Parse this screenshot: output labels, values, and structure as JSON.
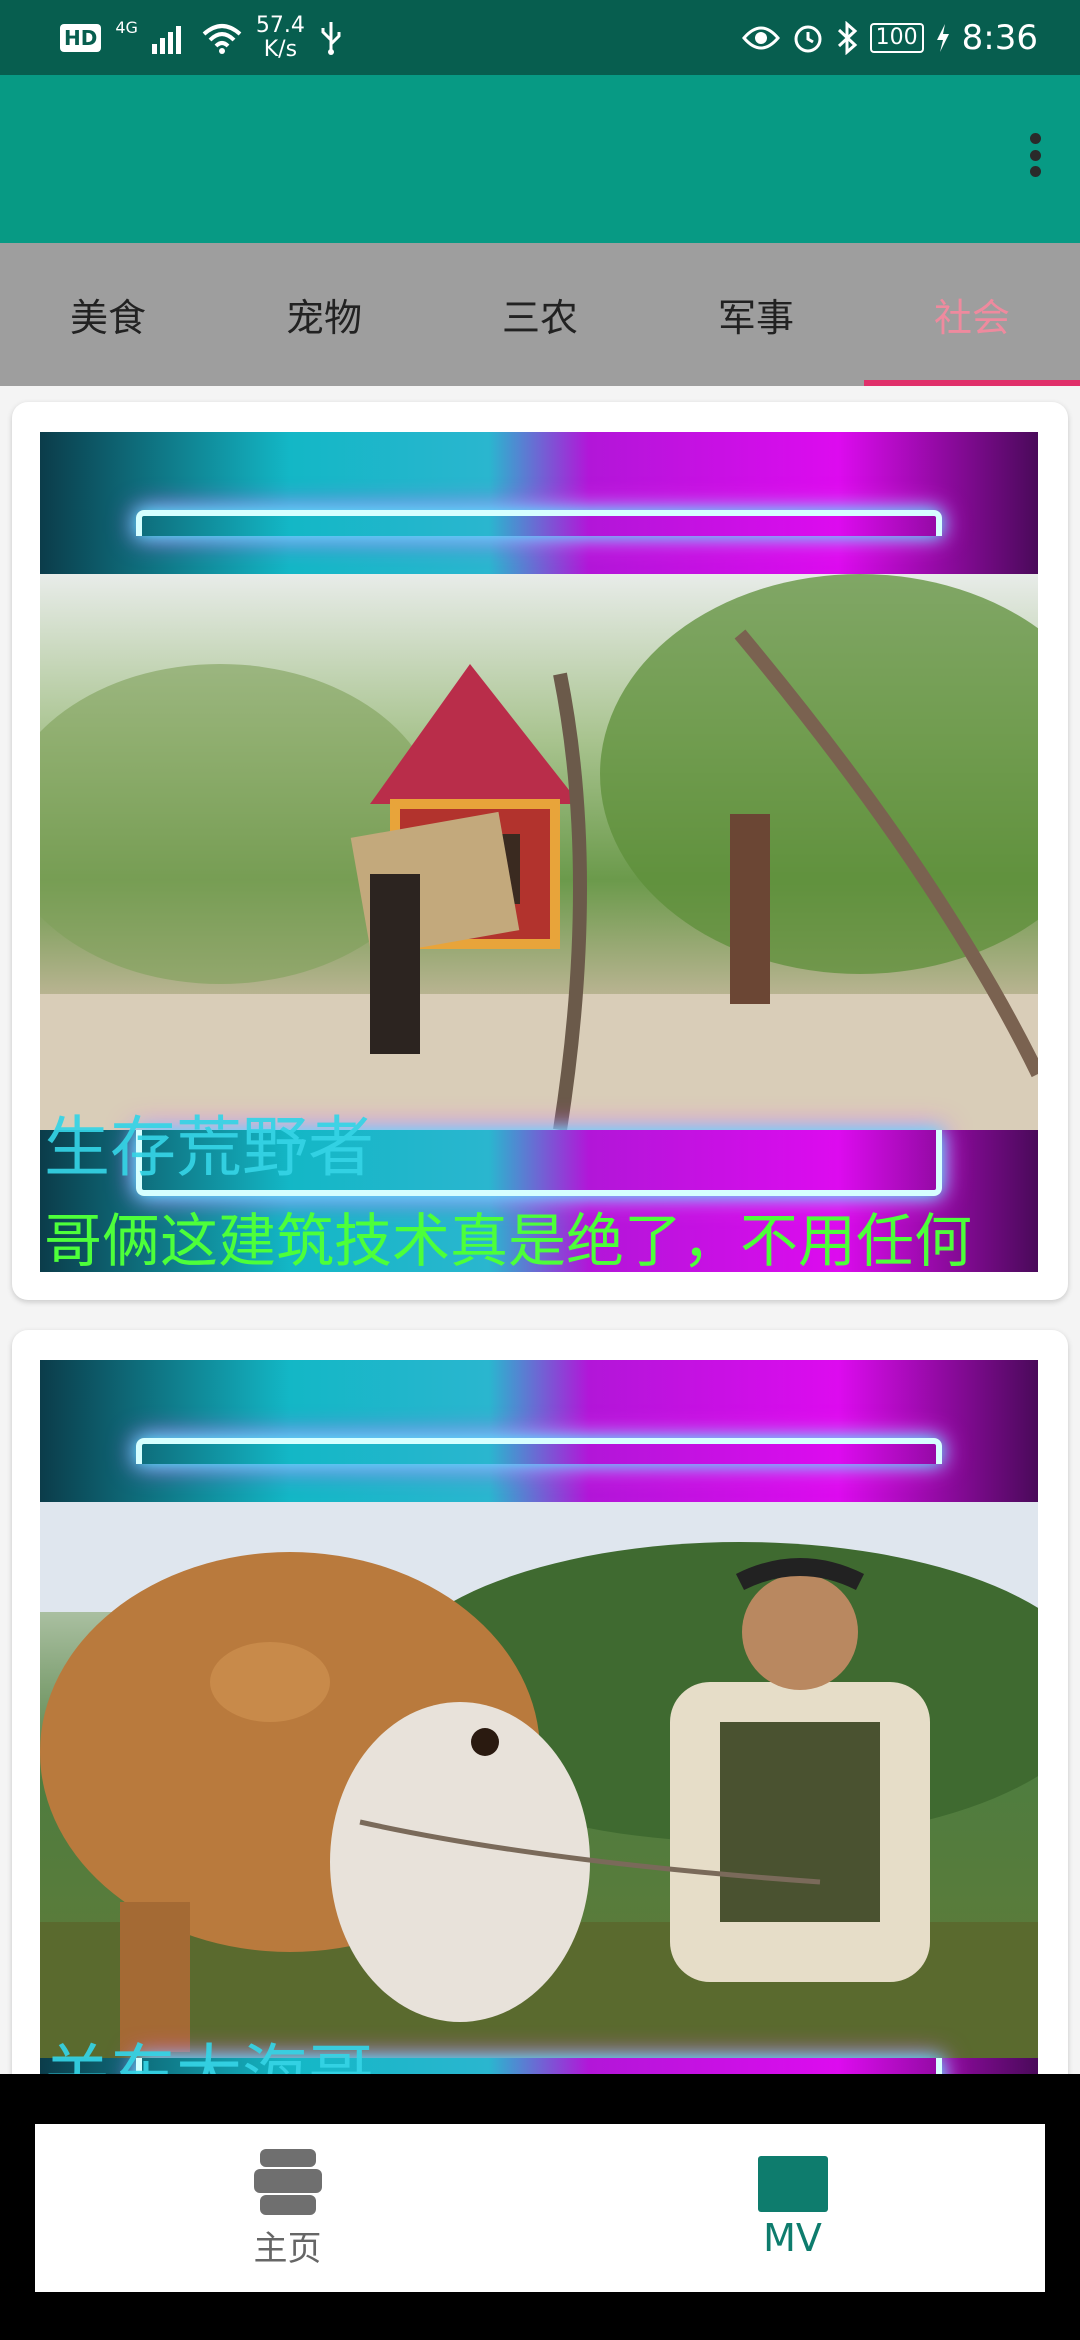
{
  "status_bar": {
    "hd": "HD",
    "network": "4G",
    "speed_value": "57.4",
    "speed_unit": "K/s",
    "battery": "100",
    "time": "8:36"
  },
  "app_bar": {
    "menu_icon": "more-vert-icon"
  },
  "tabs": [
    {
      "label": "美食",
      "active": false
    },
    {
      "label": "宠物",
      "active": false
    },
    {
      "label": "三农",
      "active": false
    },
    {
      "label": "军事",
      "active": false
    },
    {
      "label": "社会",
      "active": true
    }
  ],
  "videos": [
    {
      "channel": "生存荒野者",
      "title": "哥俩这建筑技术真是绝了，不用任何"
    },
    {
      "channel": "关东大海哥",
      "title": ""
    }
  ],
  "bottom_nav": [
    {
      "label": "主页",
      "icon": "stack-icon",
      "active": false
    },
    {
      "label": "MV",
      "icon": "square-icon",
      "active": true
    }
  ],
  "colors": {
    "status_bar": "#075e4f",
    "app_bar": "#079a84",
    "tab_bar": "#9e9e9e",
    "tab_active_text": "#ef8a9e",
    "tab_indicator": "#e0306a",
    "nav_active": "#0e7c6d"
  }
}
